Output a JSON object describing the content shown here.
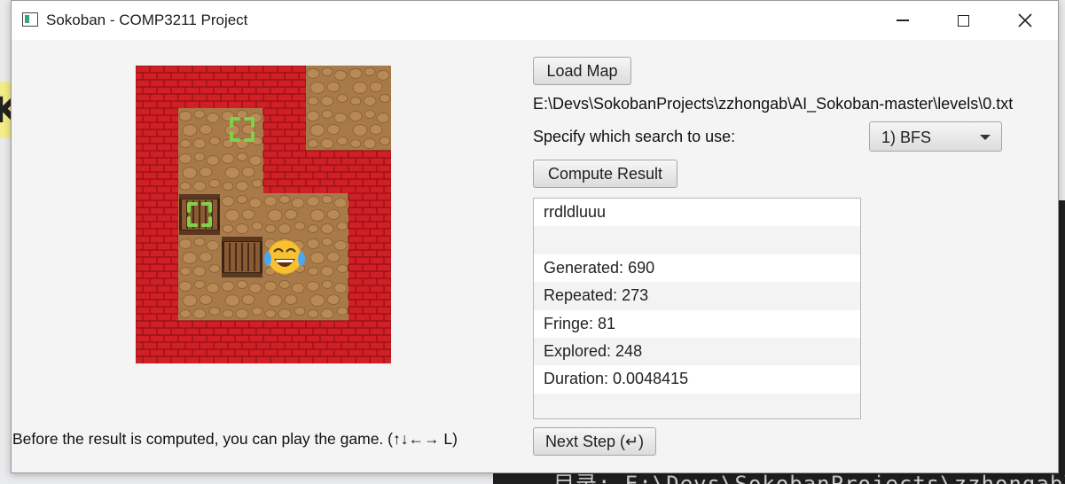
{
  "window": {
    "title": "Sokoban - COMP3211 Project"
  },
  "background": {
    "left_chip_text": "K",
    "terminal_text": "目录: E:\\Devs\\SokobanProjects\\zzhongab\\AI"
  },
  "board": {
    "legend": {
      "W": "wall",
      "F": "floor",
      "T": "target",
      "B": "box",
      "X": "box-on-target",
      "P": "player"
    },
    "rows": [
      "WWWWFF",
      "WFTWFF",
      "WFFWWW",
      "WXFFFW",
      "WFBPFW",
      "WFFFFW",
      "WWWWWW"
    ]
  },
  "controls": {
    "load_map_label": "Load Map",
    "map_path": "E:\\Devs\\SokobanProjects\\zzhongab\\AI_Sokoban-master\\levels\\0.txt",
    "search_label": "Specify which search to use:",
    "search_selected": "1) BFS",
    "compute_label": "Compute Result",
    "next_step_label": "Next Step (↵)"
  },
  "results": [
    "rrdldluuu",
    "",
    "Generated: 690",
    "Repeated: 273",
    "Fringe: 81",
    "Explored: 248",
    "Duration: 0.0048415",
    ""
  ],
  "hint": "Before the result is computed, you can play the game. (↑↓←→ L)",
  "colors": {
    "wall": "#d21f26",
    "floor": "#a87a4a",
    "target": "#7fd14a",
    "box": "#7a5030"
  }
}
